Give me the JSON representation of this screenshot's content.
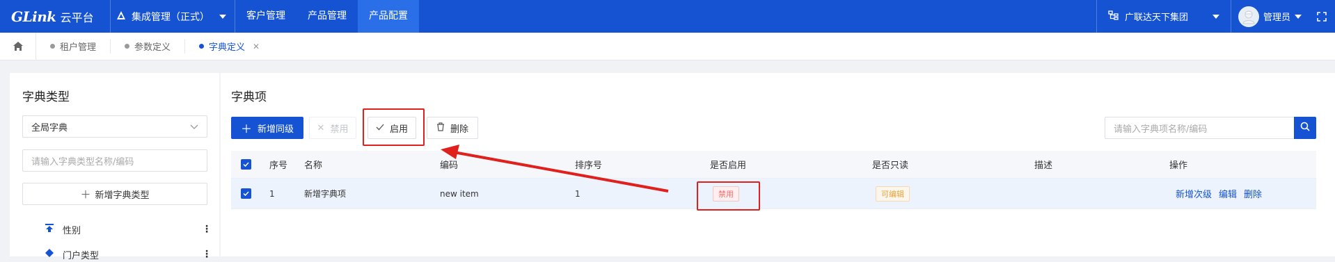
{
  "topbar": {
    "logo_mark": "GLink",
    "logo_text": "云平台",
    "system_label": "集成管理（正式）",
    "nav": [
      "客户管理",
      "产品管理",
      "产品配置"
    ],
    "active_nav": "产品配置",
    "org_label": "广联达天下集团",
    "user_label": "管理员"
  },
  "tabs": [
    {
      "label": "租户管理",
      "active": false
    },
    {
      "label": "参数定义",
      "active": false
    },
    {
      "label": "字典定义",
      "active": true,
      "closable": true
    }
  ],
  "left_panel": {
    "title": "字典类型",
    "select_value": "全局字典",
    "search_placeholder": "请输入字典类型名称/编码",
    "add_button": "新增字典类型",
    "tree": [
      "性别",
      "门户类型"
    ]
  },
  "main_panel": {
    "title": "字典项",
    "buttons": {
      "add": "新增同级",
      "disable": "禁用",
      "enable": "启用",
      "delete": "删除"
    },
    "search_placeholder": "请输入字典项名称/编码",
    "table": {
      "headers": [
        "序号",
        "名称",
        "编码",
        "排序号",
        "是否启用",
        "是否只读",
        "描述",
        "操作"
      ],
      "rows": [
        {
          "index": "1",
          "name": "新增字典项",
          "code": "new item",
          "sort": "1",
          "enabled": "禁用",
          "readonly": "可编辑",
          "description": "",
          "actions": [
            "新增次级",
            "编辑",
            "删除"
          ]
        }
      ]
    }
  },
  "colors": {
    "primary": "#1553d2",
    "annotation": "#e0201c"
  }
}
